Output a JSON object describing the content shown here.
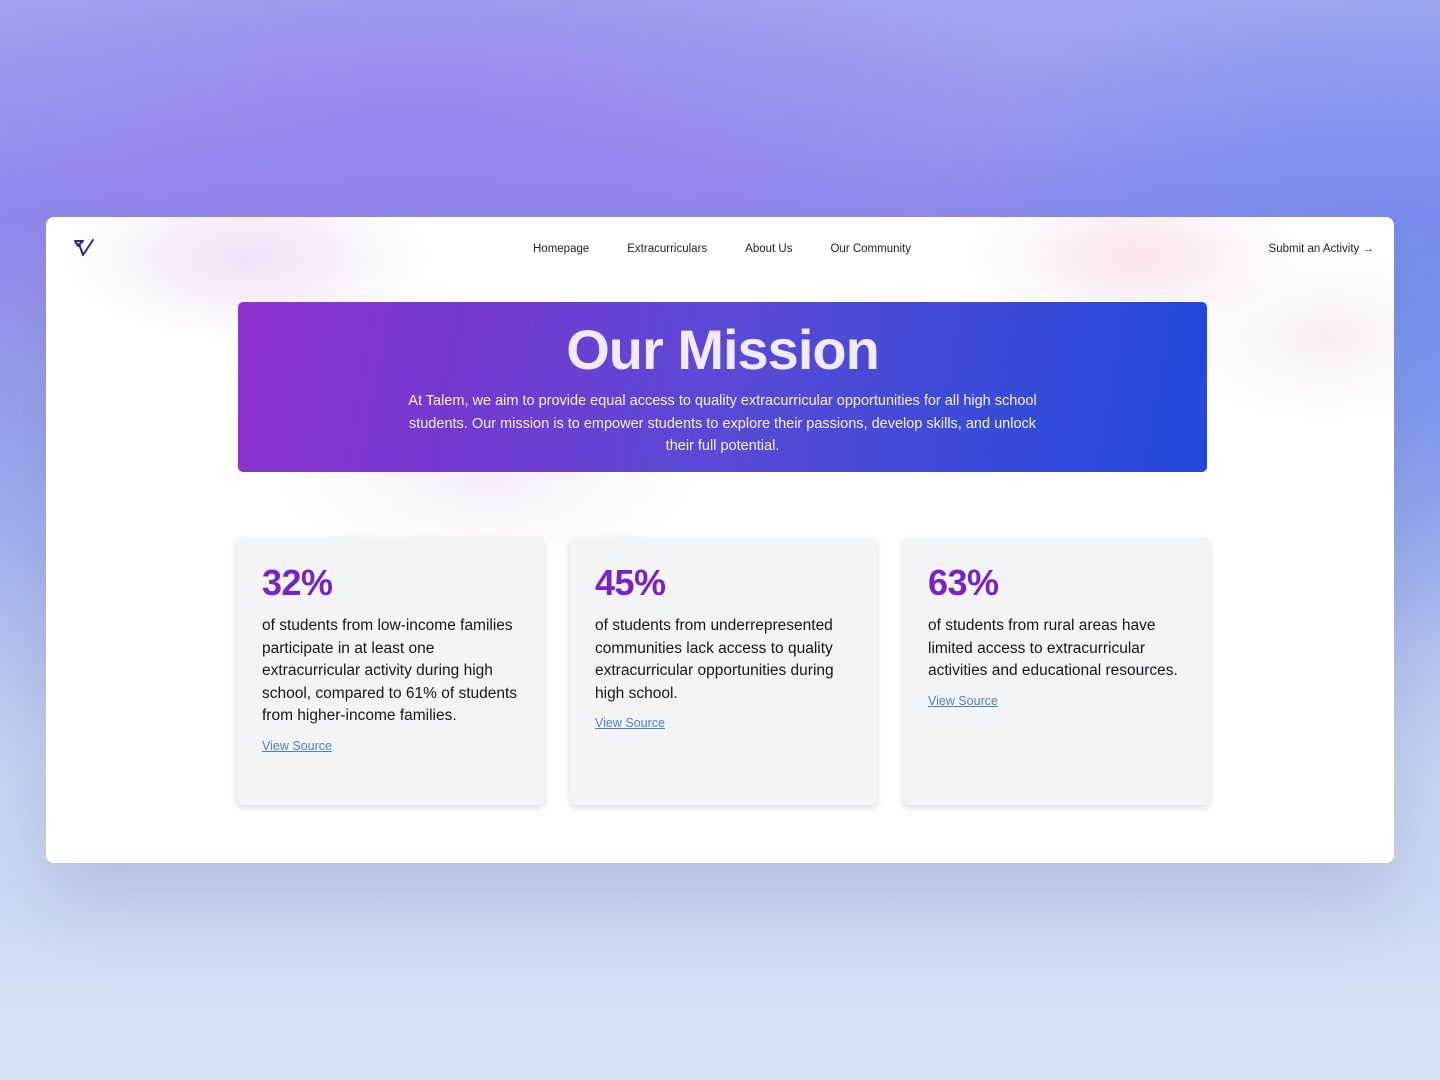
{
  "header": {
    "logo_icon": "talem-logo-icon",
    "nav": [
      {
        "label": "Homepage"
      },
      {
        "label": "Extracurriculars"
      },
      {
        "label": "About Us"
      },
      {
        "label": "Our Community"
      }
    ],
    "cta_label": "Submit an Activity →"
  },
  "hero": {
    "title": "Our Mission",
    "body": "At Talem, we aim to provide equal access to quality extracurricular opportunities for all high school students. Our mission is to empower students to explore their passions, develop skills, and unlock their full potential."
  },
  "stats": [
    {
      "value": "32%",
      "text": "of students from low-income families participate in at least one extracurricular activity during high school, compared to 61% of students from higher-income families.",
      "link": "View Source"
    },
    {
      "value": "45%",
      "text": "of students from underrepresented communities lack access to quality extracurricular opportunities during high school.",
      "link": "View Source"
    },
    {
      "value": "63%",
      "text": "of students from rural areas have limited access to extracurricular activities and educational resources.",
      "link": "View Source"
    }
  ],
  "colors": {
    "accent": "#7a22c4",
    "hero_start": "#8f34cf",
    "hero_end": "#2048dc",
    "link": "#4a7fd0"
  }
}
